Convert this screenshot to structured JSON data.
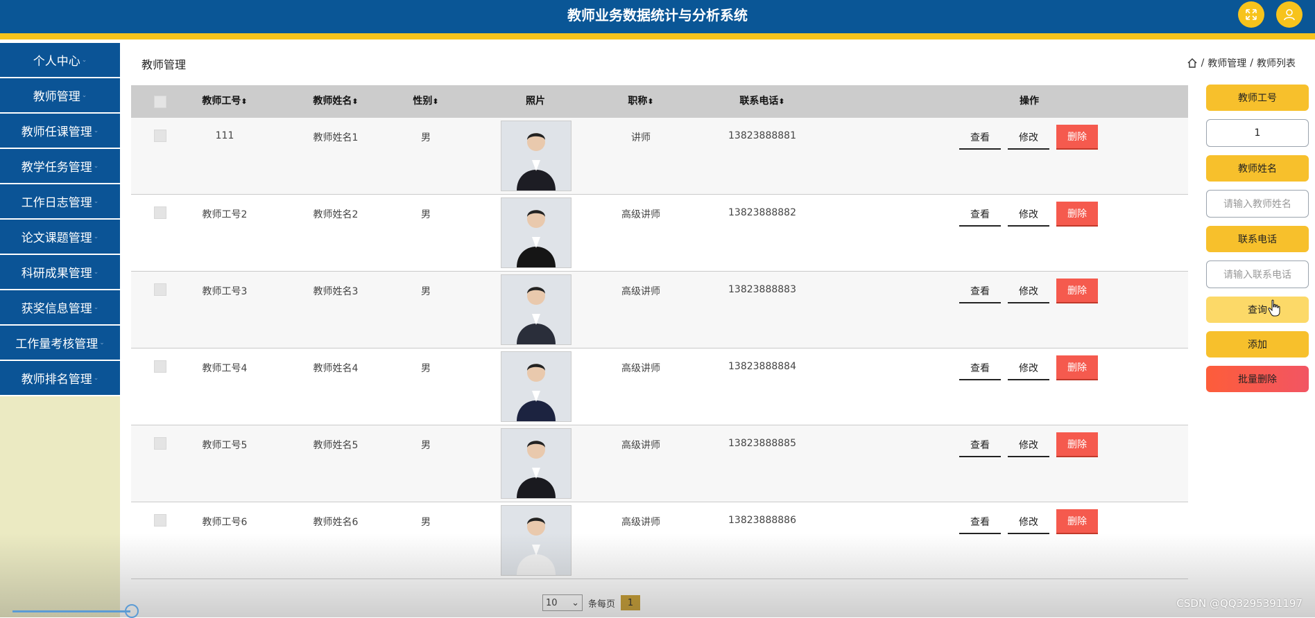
{
  "header": {
    "title": "教师业务数据统计与分析系统",
    "fullscreen_icon": "fullscreen-icon",
    "user_icon": "user-icon",
    "colors": {
      "bar": "#0a5696",
      "accent": "#f7c31c"
    }
  },
  "sidebar": {
    "items": [
      {
        "label": "个人中心"
      },
      {
        "label": "教师管理"
      },
      {
        "label": "教师任课管理"
      },
      {
        "label": "教学任务管理"
      },
      {
        "label": "工作日志管理"
      },
      {
        "label": "论文课题管理"
      },
      {
        "label": "科研成果管理"
      },
      {
        "label": "获奖信息管理"
      },
      {
        "label": "工作量考核管理"
      },
      {
        "label": "教师排名管理"
      }
    ]
  },
  "main": {
    "page_title": "教师管理",
    "breadcrumb": [
      "教师管理",
      "教师列表"
    ],
    "table": {
      "columns": {
        "id": "教师工号",
        "name": "教师姓名",
        "gender": "性别",
        "photo": "照片",
        "title": "职称",
        "phone": "联系电话",
        "actions": "操作"
      },
      "rows": [
        {
          "id": "111",
          "name": "教师姓名1",
          "gender": "男",
          "title": "讲师",
          "phone": "13823888881"
        },
        {
          "id": "教师工号2",
          "name": "教师姓名2",
          "gender": "男",
          "title": "高级讲师",
          "phone": "13823888882"
        },
        {
          "id": "教师工号3",
          "name": "教师姓名3",
          "gender": "男",
          "title": "高级讲师",
          "phone": "13823888883"
        },
        {
          "id": "教师工号4",
          "name": "教师姓名4",
          "gender": "男",
          "title": "高级讲师",
          "phone": "13823888884"
        },
        {
          "id": "教师工号5",
          "name": "教师姓名5",
          "gender": "男",
          "title": "高级讲师",
          "phone": "13823888885"
        },
        {
          "id": "教师工号6",
          "name": "教师姓名6",
          "gender": "男",
          "title": "高级讲师",
          "phone": "13823888886"
        }
      ],
      "action_labels": {
        "view": "查看",
        "edit": "修改",
        "delete": "删除"
      }
    },
    "pager": {
      "page_size": "10",
      "per_page_label": "条每页",
      "current_page": "1"
    }
  },
  "search_panel": {
    "id_label": "教师工号",
    "id_value": "1",
    "name_label": "教师姓名",
    "name_placeholder": "请输入教师姓名",
    "phone_label": "联系电话",
    "phone_placeholder": "请输入联系电话",
    "search_label": "查询",
    "add_label": "添加",
    "batch_delete_label": "批量删除"
  },
  "watermark": "CSDN @QQ3295391197"
}
